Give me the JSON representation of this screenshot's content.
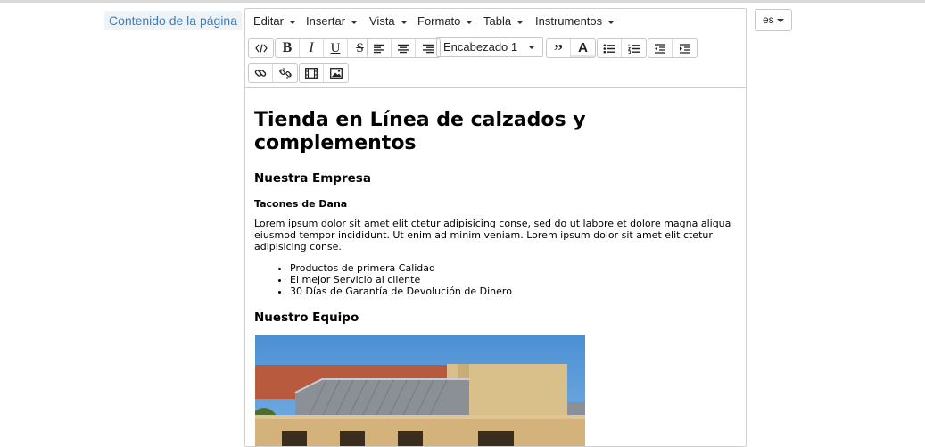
{
  "field": {
    "label": "Contenido de la página"
  },
  "menubar": {
    "items": [
      "Editar",
      "Insertar",
      "Vista",
      "Formato",
      "Tabla",
      "Instrumentos"
    ]
  },
  "toolbar": {
    "block_format": "Encabezado 1",
    "icons": [
      "source-code-icon",
      "bold-icon",
      "italic-icon",
      "underline-icon",
      "strikethrough-icon",
      "align-left-icon",
      "align-center-icon",
      "align-right-icon",
      "blockquote-icon",
      "text-color-icon",
      "bullet-list-icon",
      "numbered-list-icon",
      "outdent-icon",
      "indent-icon",
      "link-icon",
      "unlink-icon",
      "media-icon",
      "image-icon"
    ]
  },
  "content": {
    "title": "Tienda en Línea de calzados y complementos",
    "h2_company": "Nuestra Empresa",
    "h3_brand": "Tacones de Dana",
    "paragraph": "Lorem ipsum dolor sit amet elit ctetur adipisicing conse, sed do ut labore et dolore magna aliqua eiusmod tempor incididunt. Ut enim ad minim veniam. Lorem ipsum dolor sit amet elit ctetur adipisicing conse.",
    "list": [
      "Productos de primera Calidad",
      "El mejor Servicio al cliente",
      "30 Días de Garantía de Devolución de Dinero"
    ],
    "h2_team": "Nuestro Equipo"
  },
  "language": {
    "selected": "es"
  }
}
